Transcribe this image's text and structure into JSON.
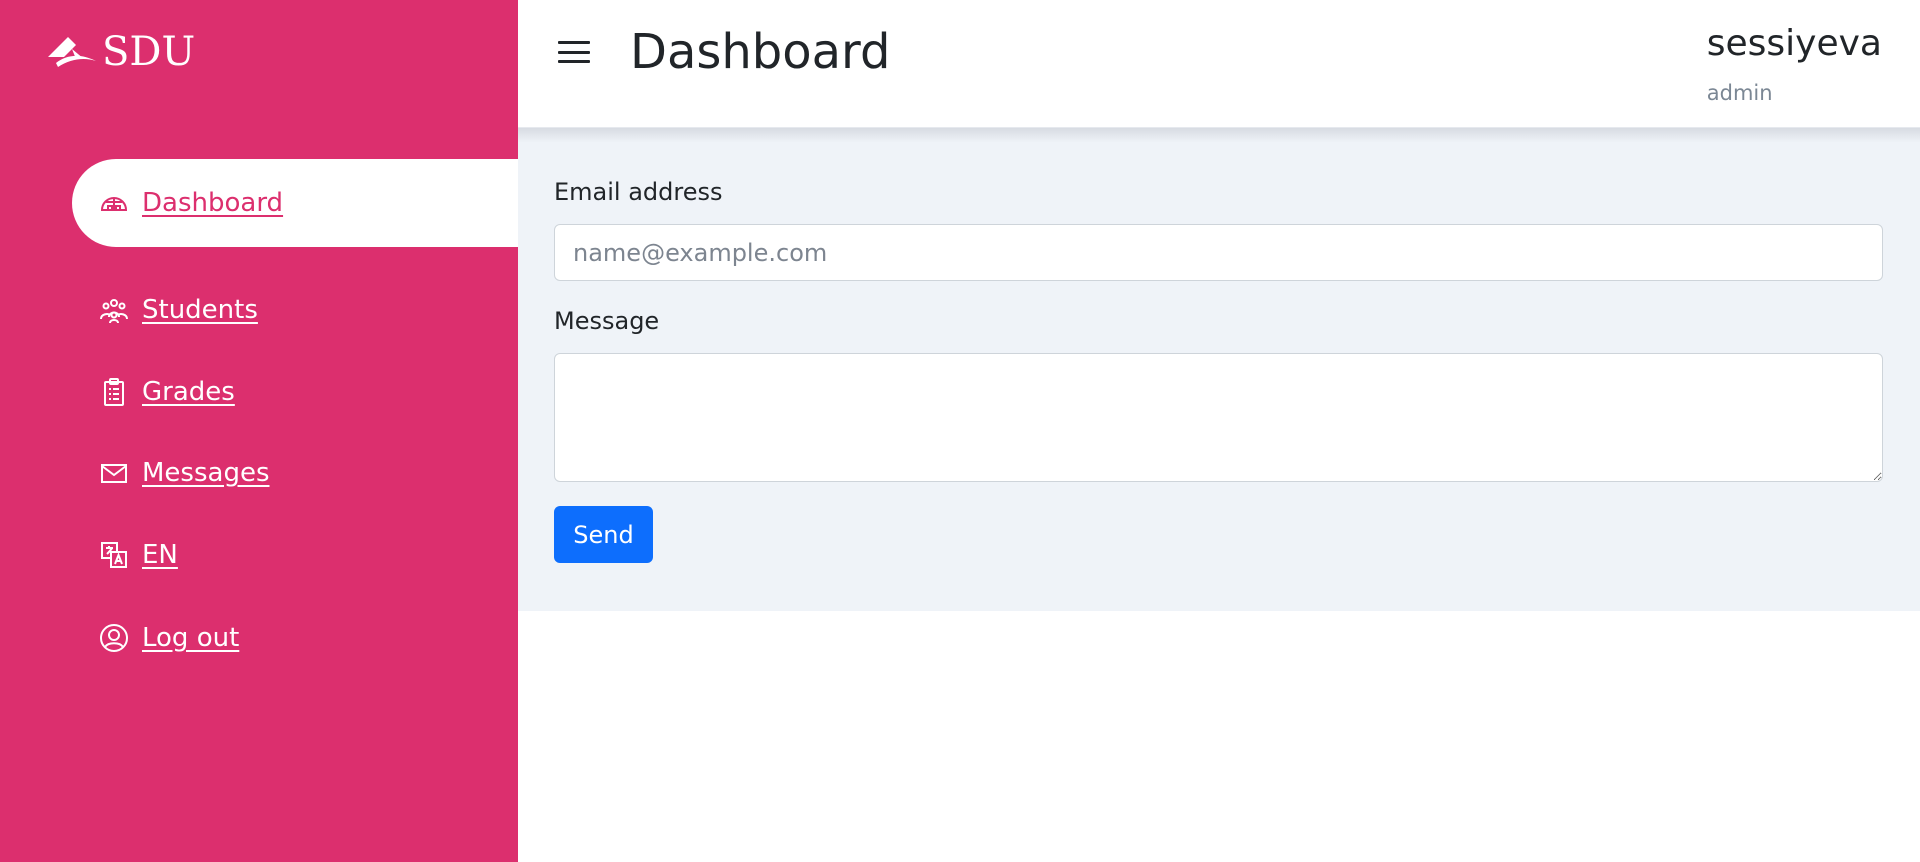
{
  "brand": {
    "logo_text": "SDU"
  },
  "sidebar": {
    "items": [
      {
        "label": " Dashboard",
        "icon": "dashboard-icon"
      },
      {
        "label": " Students",
        "icon": "students-icon"
      },
      {
        "label": " Grades",
        "icon": "clipboard-icon"
      },
      {
        "label": " Messages",
        "icon": "envelope-icon"
      },
      {
        "label": " EN",
        "icon": "translate-icon"
      },
      {
        "label": " Log out",
        "icon": "user-circle-icon"
      }
    ],
    "active_index": 0
  },
  "header": {
    "title": "Dashboard",
    "user_name": "sessiyeva",
    "user_role": "admin"
  },
  "form": {
    "email_label": "Email address",
    "email_placeholder": "name@example.com",
    "email_value": "",
    "message_label": "Message",
    "message_value": "",
    "send_label": "Send"
  },
  "colors": {
    "sidebar_bg": "#dc2f6e",
    "content_bg": "#eff3f8",
    "primary_button": "#0d6efd"
  }
}
